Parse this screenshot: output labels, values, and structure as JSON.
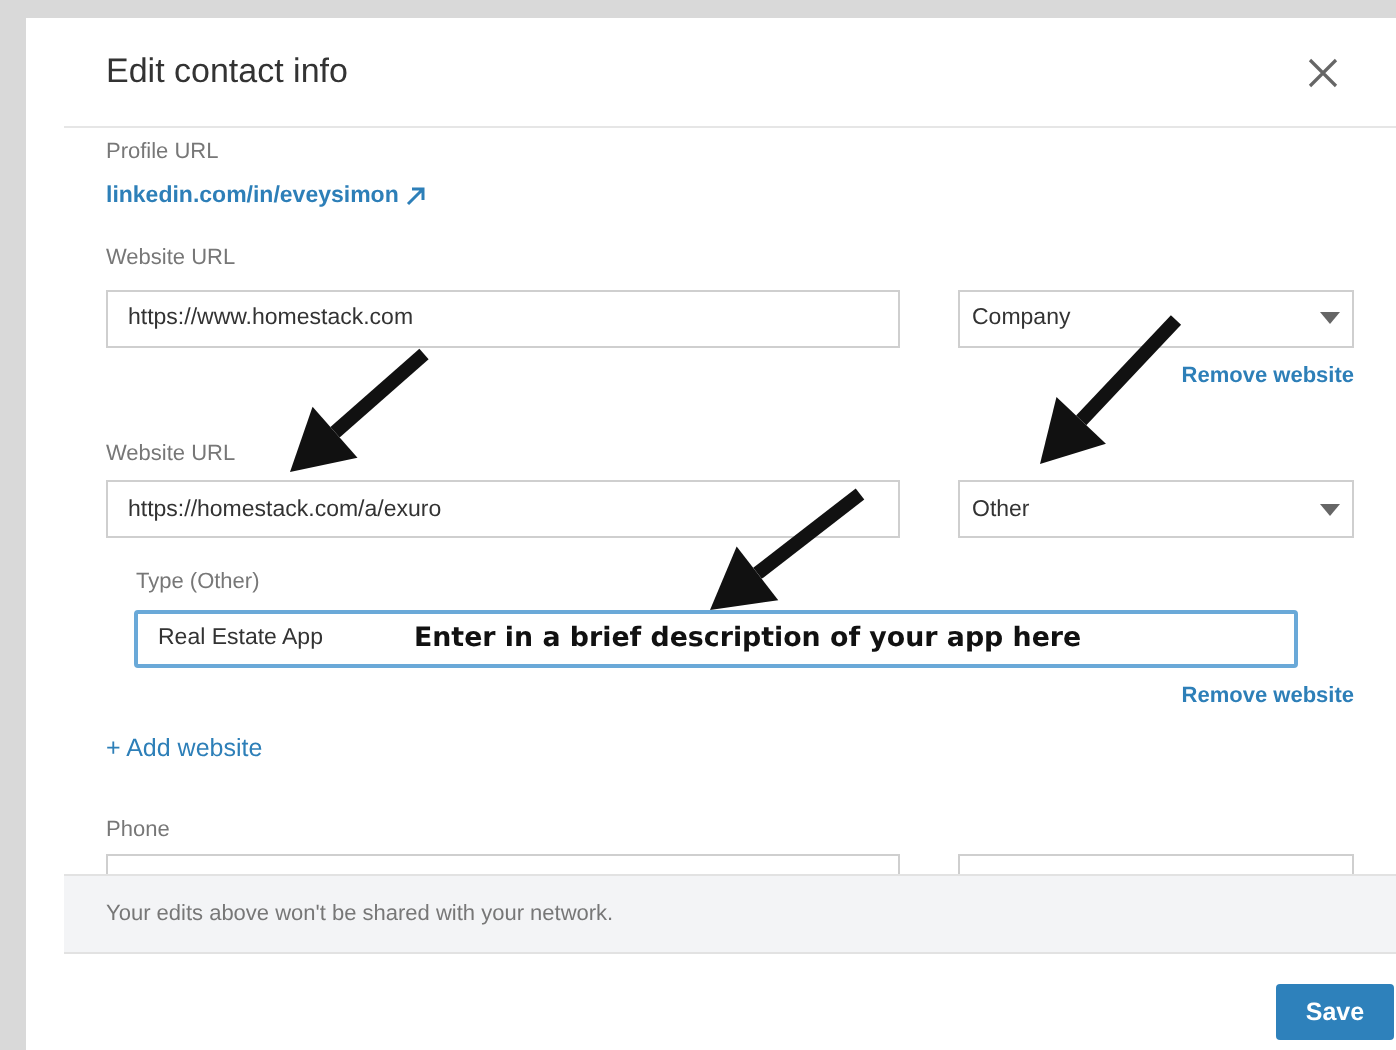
{
  "dialog": {
    "title": "Edit contact info"
  },
  "profile": {
    "label": "Profile URL",
    "link": "linkedin.com/in/eveysimon"
  },
  "websites": [
    {
      "label": "Website URL",
      "url": "https://www.homestack.com",
      "type": "Company",
      "remove": "Remove website"
    },
    {
      "label": "Website URL",
      "url": "https://homestack.com/a/exuro",
      "type": "Other",
      "type_label": "Type (Other)",
      "type_value": "Real Estate App",
      "type_focused": true,
      "remove": "Remove website"
    }
  ],
  "add_website": "+ Add website",
  "phone": {
    "label": "Phone"
  },
  "footer_note": "Your edits above won't be shared with your network.",
  "save": "Save",
  "annotation": "Enter in a brief description of your app here"
}
